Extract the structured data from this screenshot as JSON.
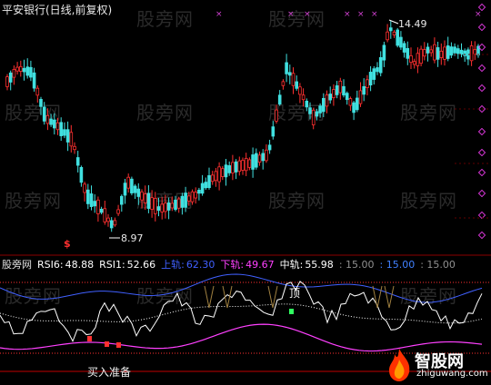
{
  "header": {
    "title": "平安银行(日线,前复权)"
  },
  "watermark": {
    "text": "股旁网"
  },
  "price_chart": {
    "high_label": "14.49",
    "low_label": "8.97",
    "signal_label": "$"
  },
  "indicator": {
    "name": "股旁网",
    "rsi6_label": "RSI6:",
    "rsi6_value": "48.88",
    "rsi1_label": "RSI1:",
    "rsi1_value": "52.66",
    "upper_label": "上轨:",
    "upper_value": "62.30",
    "lower_label": "下轨:",
    "lower_value": "49.67",
    "mid_label": "中轨:",
    "mid_value": "55.98",
    "c1": ": 15.00",
    "c2": ": 15.00",
    "c3": ": 15.00",
    "buy_signal": "买入准备",
    "top_signal": "顶"
  },
  "logo": {
    "brand": "智股网",
    "site": "zhiguwang.com"
  },
  "colors": {
    "up": "#ff3030",
    "down": "#40e0e0",
    "rsi6": "#ffffff",
    "upper": "#4060ff",
    "lower": "#ff40ff",
    "mid": "#ffffff"
  }
}
